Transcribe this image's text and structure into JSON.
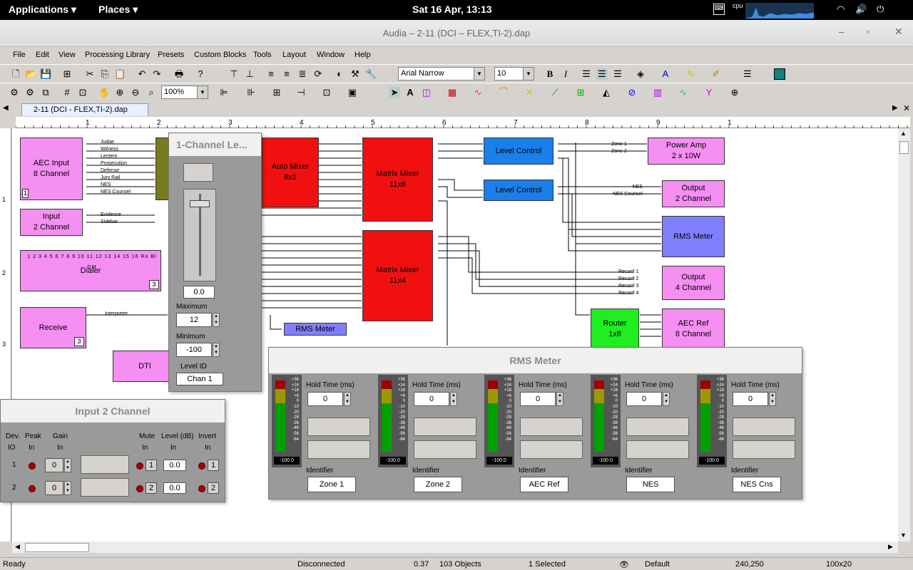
{
  "topbar": {
    "applications": "Applications ▾",
    "places": "Places ▾",
    "clock": "Sat 16 Apr, 13:13",
    "cpu": "cpu"
  },
  "window": {
    "title": "Audia – 2-11 (DCI – FLEX,TI-2).dap"
  },
  "menu": [
    "File",
    "Edit",
    "View",
    "Processing Library",
    "Presets",
    "Custom Blocks",
    "Tools",
    "Layout",
    "Window",
    "Help"
  ],
  "toolbar": {
    "font": "Arial Narrow",
    "size": "10",
    "zoom": "100%"
  },
  "tab": {
    "label": "2-11 (DCI - FLEX,TI-2).dap"
  },
  "ruler": [
    "1",
    "2",
    "3",
    "4",
    "5",
    "6",
    "7",
    "8",
    "9",
    "1"
  ],
  "vruler": [
    "1",
    "2",
    "3"
  ],
  "blocks": {
    "aec_input": "AEC Input\n8 Channel",
    "aec_input_badge": "1",
    "input2": "Input\n2 Channel",
    "dialer": "Dialer",
    "dialer_badge": "3",
    "receive": "Receive",
    "receive_badge": "3",
    "dtmf": "DTI",
    "auto_mixer": "Auto Mixer\n8x1",
    "matrix1": "Matrix Mixer\n11x6",
    "matrix2": "Matrix Mixer\n11x4",
    "level1": "Level Control",
    "level2": "Level Control",
    "power_amp": "Power Amp\n2 x 10W",
    "output2": "Output\n2 Channel",
    "rms_meter_block": "RMS Meter",
    "output4": "Output\n4 Channel",
    "rms_small": "RMS Meter",
    "router": "Router\n1x8",
    "aec_ref": "AEC Ref\n8 Channel"
  },
  "wire_labels": {
    "aec": [
      "Judge",
      "Witness",
      "Lectern",
      "Prosecution",
      "Defense",
      "Jury Rail",
      "NES",
      "NES Counsel"
    ],
    "input2": [
      "Evidence",
      "Sidebar"
    ],
    "receive": "Interpreter",
    "zones": [
      "Zone 1",
      "Zone 2"
    ],
    "nes": [
      "NES",
      "NES Counsel"
    ],
    "records": [
      "Record 1",
      "Record 2",
      "Record 3",
      "Record 4"
    ]
  },
  "dialer_labels": [
    "1",
    "2",
    "3",
    "4",
    "5",
    "6",
    "7",
    "8",
    "9",
    "10",
    "11",
    "12",
    "13",
    "14",
    "15",
    "16",
    "Ro",
    "Bl",
    "DM"
  ],
  "level_panel": {
    "title": "1-Channel Le...",
    "value": "0.0",
    "max_label": "Maximum",
    "max": "12",
    "min_label": "Minimum",
    "min": "-100",
    "id_label": "Level ID",
    "id": "Chan 1",
    "fader_level": 0.92
  },
  "input_panel": {
    "title": "Input 2 Channel",
    "headers": [
      "Dev.",
      "Peak",
      "Gain",
      "Mute",
      "Level (dB)",
      "Invert"
    ],
    "subheaders": [
      "IO",
      "In",
      "In",
      "In",
      "In",
      "In"
    ],
    "rows": [
      {
        "io": "1",
        "gain": "0",
        "mute": "1",
        "level": "0.0",
        "invert": "1"
      },
      {
        "io": "2",
        "gain": "0",
        "mute": "2",
        "level": "0.0",
        "invert": "2"
      }
    ]
  },
  "rms_panel": {
    "title": "RMS Meter",
    "hold_label": "Hold Time (ms)",
    "id_label": "Identifier",
    "scale": [
      "+36",
      "+24",
      "+18",
      "+6",
      "0",
      "-10",
      "-20",
      "-28",
      "-36",
      "-46",
      "-56",
      "-64"
    ],
    "meters": [
      {
        "hold": "0",
        "value": "-100.0",
        "id": "Zone 1"
      },
      {
        "hold": "0",
        "value": "-100.0",
        "id": "Zone 2"
      },
      {
        "hold": "0",
        "value": "-100.0",
        "id": "AEC Ref"
      },
      {
        "hold": "0",
        "value": "-100.0",
        "id": "NES"
      },
      {
        "hold": "0",
        "value": "-100.0",
        "id": "NES Cns"
      }
    ]
  },
  "status": {
    "ready": "Ready",
    "conn": "Disconnected",
    "ver": "0.37",
    "objects": "103 Objects",
    "selected": "1 Selected",
    "preset": "Default",
    "coords": "240,250",
    "size": "100x20"
  },
  "colors": {
    "pink": "#f58ff2",
    "red": "#f01010",
    "blue": "#1a7fe8",
    "lavender": "#8080ff",
    "green": "#20ee20"
  }
}
